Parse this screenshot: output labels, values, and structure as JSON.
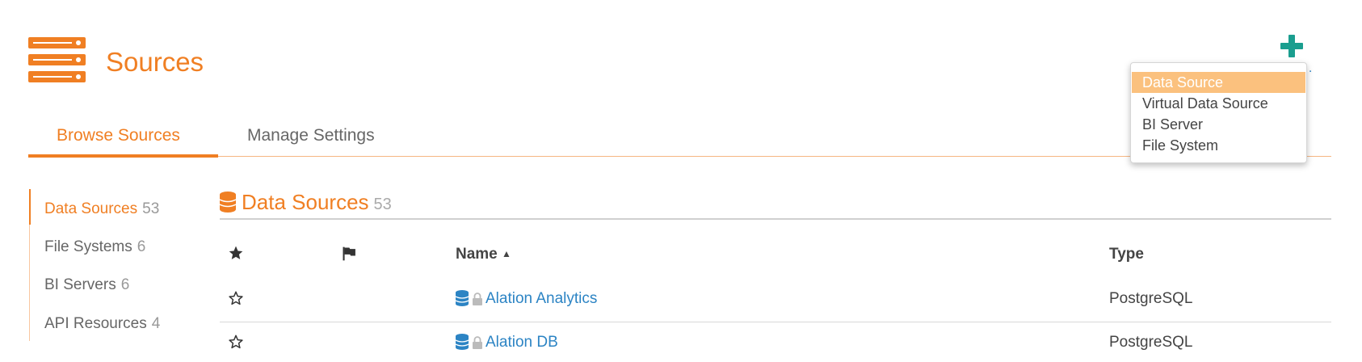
{
  "header": {
    "title": "Sources",
    "icon": "server-stack-icon",
    "add_icon": "plus-icon",
    "more_label": "..."
  },
  "tabs": [
    {
      "label": "Browse Sources",
      "active": true
    },
    {
      "label": "Manage Settings",
      "active": false
    }
  ],
  "sidebar": {
    "items": [
      {
        "label": "Data Sources",
        "count": "53",
        "active": true
      },
      {
        "label": "File Systems",
        "count": "6",
        "active": false
      },
      {
        "label": "BI Servers",
        "count": "6",
        "active": false
      },
      {
        "label": "API Resources",
        "count": "4",
        "active": false
      }
    ]
  },
  "section": {
    "title": "Data Sources",
    "count": "53",
    "icon": "database-icon"
  },
  "table": {
    "columns": {
      "star": "star-icon",
      "flag": "flag-icon",
      "name": "Name",
      "sort_indicator": "▲",
      "type": "Type"
    },
    "rows": [
      {
        "name": "Alation Analytics",
        "type": "PostgreSQL"
      },
      {
        "name": "Alation DB",
        "type": "PostgreSQL"
      }
    ]
  },
  "dropdown": {
    "items": [
      {
        "label": "Data Source",
        "highlighted": true
      },
      {
        "label": "Virtual Data Source",
        "highlighted": false
      },
      {
        "label": "BI Server",
        "highlighted": false
      },
      {
        "label": "File System",
        "highlighted": false
      }
    ]
  },
  "colors": {
    "accent": "#f07f23",
    "link": "#2c84c4",
    "add_button": "#1a9e8f",
    "dropdown_highlight": "#fbc17e"
  }
}
